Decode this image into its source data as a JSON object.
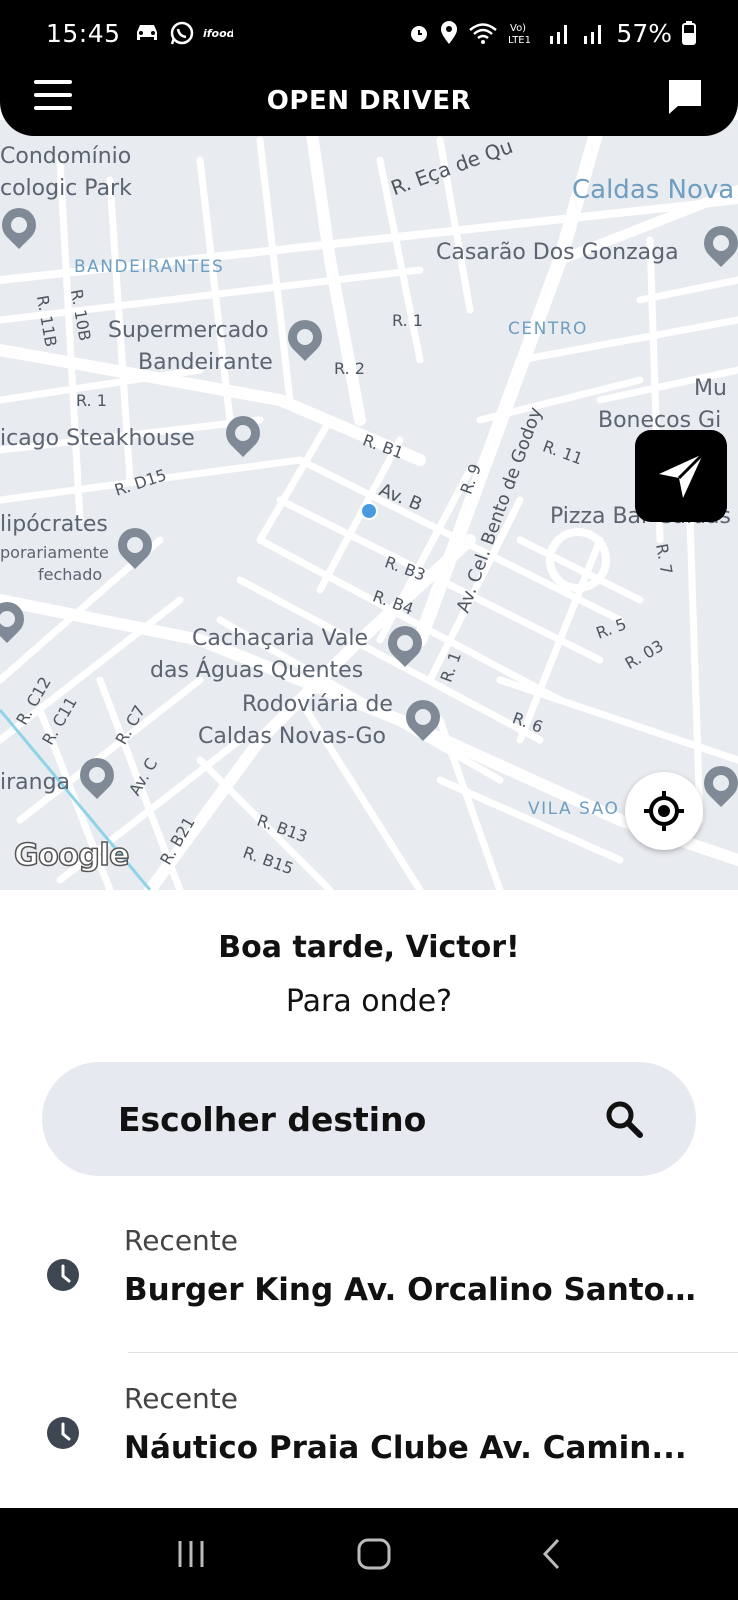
{
  "status_bar": {
    "time": "15:45",
    "battery": "57%",
    "icons_left": [
      "car-icon",
      "whatsapp-icon",
      "ifood-icon"
    ],
    "icons_right": [
      "alarm-icon",
      "location-icon",
      "wifi-icon",
      "volte-icon",
      "signal-icon",
      "signal-icon",
      "battery-icon"
    ]
  },
  "app_bar": {
    "title": "OPEN DRIVER"
  },
  "map": {
    "labels": {
      "condominio": "Condomínio",
      "ecologic": "cologic Park",
      "rua_eca": "R. Eça de Qu",
      "caldas_novas": "Caldas Nova",
      "bandeirantes": "BANDEIRANTES",
      "casarao": "Casarão Dos Gonzaga",
      "supermercado_1": "Supermercado",
      "supermercado_2": "Bandeirante",
      "r1a": "R. 1",
      "centro": "CENTRO",
      "r2": "R. 2",
      "r1b": "R. 1",
      "steakhouse": "icago Steakhouse",
      "rb1": "R. B1",
      "museu": "Mu",
      "bonecos": "Bonecos Gi",
      "r11": "R. 11",
      "rd15": "R. D15",
      "avb": "Av. B",
      "r9": "R. 9",
      "bento": "Av. Cel. Bento de Godoy",
      "pizza": "Pizza Bar Caldas",
      "hipocrates": "lipócrates",
      "temp": "porariamente",
      "fechado": "fechado",
      "rb3": "R. B3",
      "rb4": "R. B4",
      "r7": "R. 7",
      "cachacaria_1": "Cachaçaria Vale",
      "cachacaria_2": "das Águas Quentes",
      "r5": "R. 5",
      "r03": "R. 03",
      "r1c": "R. 1",
      "rc12": "R. C12",
      "rc11": "R. C11",
      "rc7": "R. C7",
      "rodoviaria_1": "Rodoviária de",
      "rodoviaria_2": "Caldas Novas-Go",
      "r6": "R. 6",
      "iranga": "iranga",
      "avc": "Av. C",
      "vila_sao": "VILA SAO",
      "rb21": "R. B21",
      "rb13": "R. B13",
      "rb15": "R. B15",
      "r10b": "R. 10B",
      "r11b": "R. 11B"
    },
    "attribution": "Google"
  },
  "sheet": {
    "greeting": "Boa tarde, Victor!",
    "question": "Para onde?",
    "search_placeholder": "Escolher destino",
    "recents": [
      {
        "label": "Recente",
        "place": "Burger King Av. Orcalino Santos,..."
      },
      {
        "label": "Recente",
        "place": "Náutico Praia Clube Av. Camin..."
      }
    ]
  },
  "nav_bar": {
    "buttons": [
      "recent-apps-icon",
      "home-icon",
      "back-icon"
    ]
  }
}
